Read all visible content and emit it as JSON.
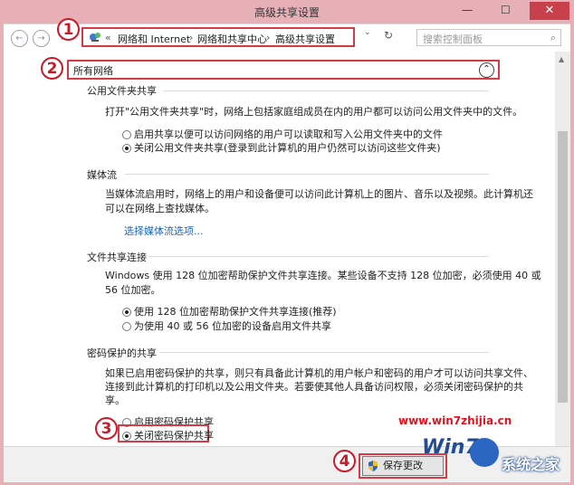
{
  "window": {
    "title": "高级共享设置",
    "minimize": "—",
    "maximize": "☐",
    "close": "✕"
  },
  "nav": {
    "back": "←",
    "forward": "→",
    "up": "↑",
    "breadcrumb_prefix": "«",
    "breadcrumbs": [
      "网络和 Internet",
      "网络和共享中心",
      "高级共享设置"
    ],
    "separator": "›",
    "dropdown": "⌄",
    "refresh": "↻",
    "search_placeholder": "搜索控制面板",
    "search_icon": "⌕"
  },
  "section": {
    "title": "所有网络",
    "collapse": "⌃"
  },
  "public_folder": {
    "heading": "公用文件夹共享",
    "description": "打开\"公用文件夹共享\"时，网络上包括家庭组成员在内的用户都可以访问公用文件夹中的文件。",
    "options": [
      {
        "label": "启用共享以便可以访问网络的用户可以读取和写入公用文件夹中的文件",
        "selected": false
      },
      {
        "label": "关闭公用文件夹共享(登录到此计算机的用户仍然可以访问这些文件夹)",
        "selected": true
      }
    ]
  },
  "media": {
    "heading": "媒体流",
    "description_line1": "当媒体流启用时，网络上的用户和设备便可以访问此计算机上的图片、音乐以及视频。此计算机还",
    "description_line2": "可以在网络上查找媒体。",
    "link": "选择媒体流选项..."
  },
  "file_sharing": {
    "heading": "文件共享连接",
    "description_line1": "Windows 使用 128 位加密帮助保护文件共享连接。某些设备不支持 128 位加密，必须使用 40 或",
    "description_line2": "56 位加密。",
    "options": [
      {
        "label": "使用 128 位加密帮助保护文件共享连接(推荐)",
        "selected": true
      },
      {
        "label": "为使用 40 或 56 位加密的设备启用文件共享",
        "selected": false
      }
    ]
  },
  "password": {
    "heading": "密码保护的共享",
    "description_line1": "如果已启用密码保护的共享，则只有具备此计算机的用户帐户和密码的用户才可以访问共享文件、",
    "description_line2": "连接到此计算机的打印机以及公用文件夹。若要使其他人具备访问权限，必须关闭密码保护的共",
    "description_line3": "享。",
    "options": [
      {
        "label": "启用密码保护共享",
        "selected": false
      },
      {
        "label": "关闭密码保护共享",
        "selected": true
      }
    ]
  },
  "footer": {
    "save_label": "保存更改"
  },
  "markers": [
    "1",
    "2",
    "3",
    "4"
  ],
  "watermark": {
    "url": "www.win7zhijia.cn",
    "brand": "Win7",
    "site": "系统之家"
  },
  "colors": {
    "accent_red": "#d63b45",
    "link_blue": "#1e64b4",
    "frame_pink": "#e7b0b6"
  }
}
